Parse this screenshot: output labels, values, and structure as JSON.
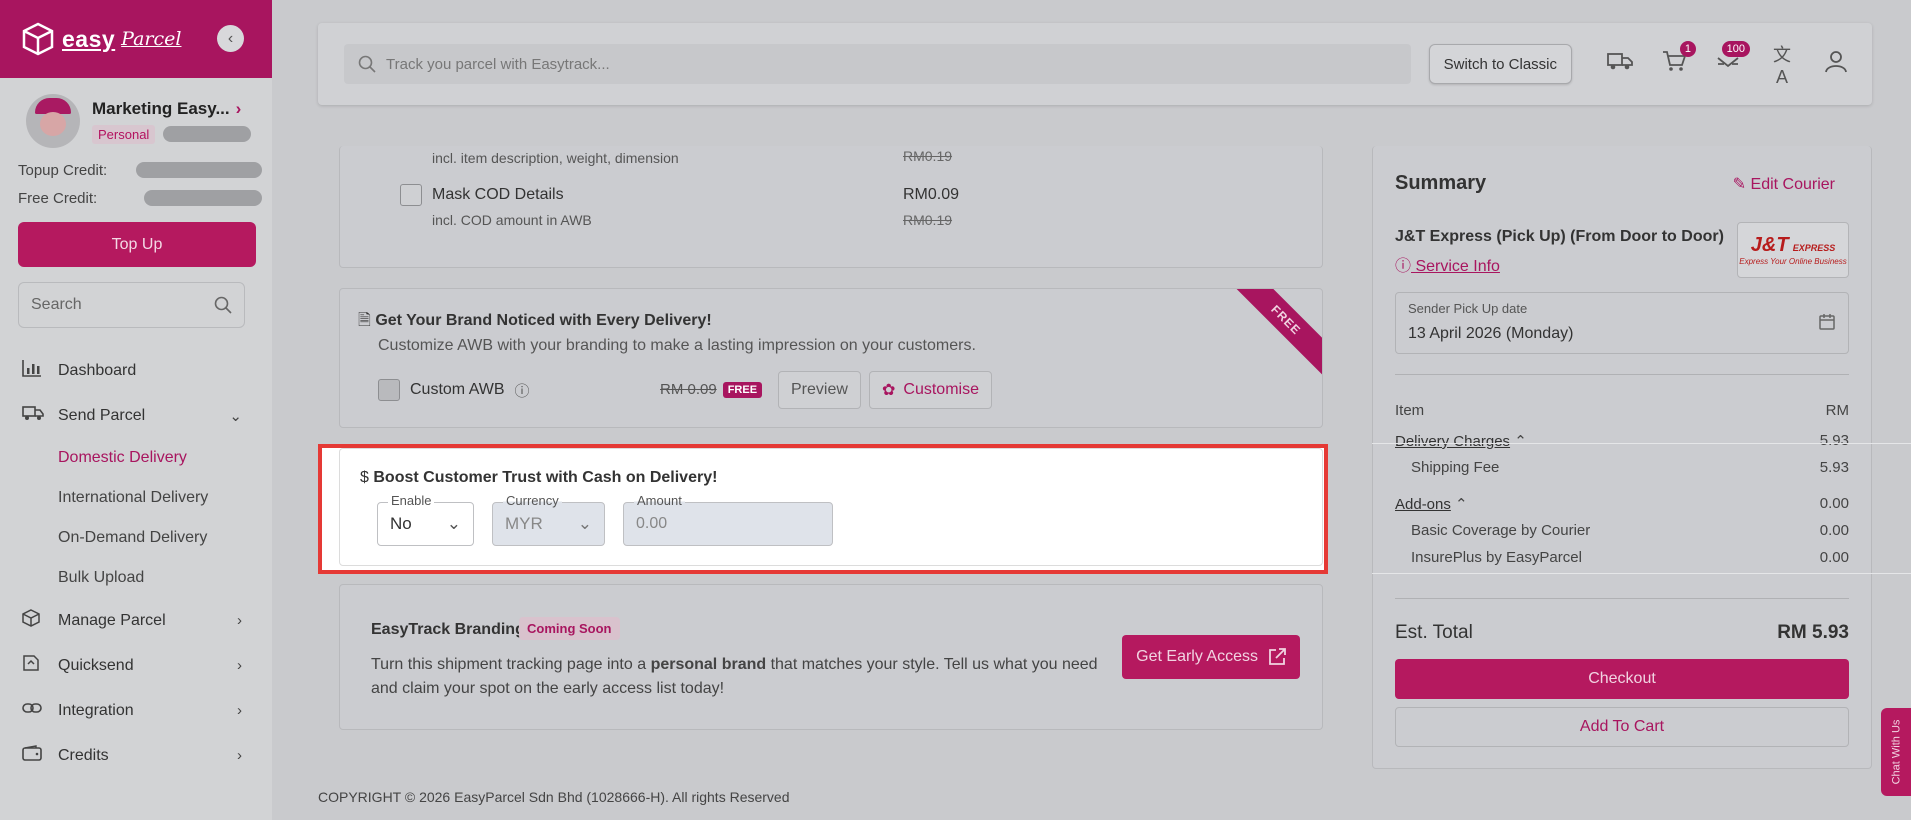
{
  "brand": {
    "word1": "easy",
    "word2": "Parcel"
  },
  "profile": {
    "name": "Marketing Easy...",
    "type": "Personal"
  },
  "credits": {
    "topup_label": "Topup Credit:",
    "free_label": "Free Credit:",
    "topup_button": "Top Up"
  },
  "sidebar_search": {
    "placeholder": "Search"
  },
  "nav": {
    "dashboard": "Dashboard",
    "send_parcel": "Send Parcel",
    "domestic": "Domestic Delivery",
    "international": "International Delivery",
    "ondemand": "On-Demand Delivery",
    "bulk": "Bulk Upload",
    "manage": "Manage Parcel",
    "quicksend": "Quicksend",
    "integration": "Integration",
    "credits": "Credits"
  },
  "topbar": {
    "track_placeholder": "Track you parcel with Easytrack...",
    "switch_label": "Switch to Classic",
    "cart_count": "1",
    "notif_count": "100"
  },
  "addons": {
    "row1_sub": "incl. item description, weight, dimension",
    "row1_price_strike": "RM0.19",
    "row2_label": "Mask COD Details",
    "row2_sub": "incl. COD amount in AWB",
    "row2_price": "RM0.09",
    "row2_price_strike": "RM0.19"
  },
  "branding": {
    "title": "Get Your Brand Noticed with Every Delivery!",
    "desc": "Customize AWB with your branding to make a lasting impression on your customers.",
    "custom_awb": "Custom AWB",
    "price_strike": "RM 0.09",
    "free": "FREE",
    "preview": "Preview",
    "customise": "Customise",
    "ribbon": "FREE"
  },
  "cod": {
    "title": "Boost Customer Trust with Cash on Delivery!",
    "enable_label": "Enable",
    "enable_value": "No",
    "currency_label": "Currency",
    "currency_value": "MYR",
    "amount_label": "Amount",
    "amount_placeholder": "0.00"
  },
  "easytrack": {
    "title": "EasyTrack Branding",
    "badge": "Coming Soon",
    "desc_pre": "Turn this shipment tracking page into a ",
    "desc_bold": "personal brand",
    "desc_post": " that matches your style. Tell us what you need and claim your spot on the early access list today!",
    "button": "Get Early Access"
  },
  "footer": "COPYRIGHT © 2026 EasyParcel Sdn Bhd (1028666-H). All rights Reserved",
  "summary": {
    "title": "Summary",
    "edit_courier": "Edit Courier",
    "courier_name": "J&T Express (Pick Up) (From Door to Door)",
    "service_info": "Service Info",
    "logo_text": "J&T",
    "logo_sub": "EXPRESS",
    "logo_tagline": "Express Your Online Business",
    "pickup_label": "Sender Pick Up date",
    "pickup_value": "13 April 2026 (Monday)",
    "item_label": "Item",
    "item_unit": "RM",
    "delivery_label": "Delivery Charges",
    "delivery_value": "5.93",
    "shipping_label": "Shipping Fee",
    "shipping_value": "5.93",
    "addons_label": "Add-ons",
    "addons_value": "0.00",
    "basic_label": "Basic Coverage by Courier",
    "basic_value": "0.00",
    "insure_label": "InsurePlus by EasyParcel",
    "insure_value": "0.00",
    "total_label": "Est. Total",
    "total_value": "RM 5.93",
    "checkout": "Checkout",
    "add_to_cart": "Add To Cart"
  },
  "chat": "Chat With Us"
}
